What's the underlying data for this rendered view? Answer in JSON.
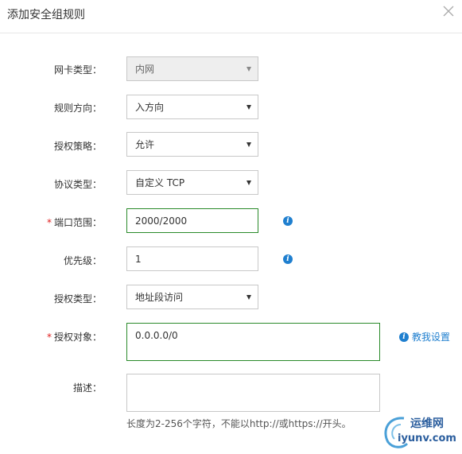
{
  "dialog": {
    "title": "添加安全组规则"
  },
  "form": {
    "nic_type": {
      "label": "网卡类型：",
      "value": "内网"
    },
    "direction": {
      "label": "规则方向：",
      "value": "入方向"
    },
    "policy": {
      "label": "授权策略：",
      "value": "允许"
    },
    "protocol": {
      "label": "协议类型：",
      "value": "自定义 TCP"
    },
    "port_range": {
      "label": "端口范围：",
      "required_mark": "*",
      "value": "2000/2000"
    },
    "priority": {
      "label": "优先级：",
      "value": "1"
    },
    "auth_type": {
      "label": "授权类型：",
      "value": "地址段访问"
    },
    "auth_object": {
      "label": "授权对象：",
      "required_mark": "*",
      "value": "0.0.0.0/0",
      "help_link": "教我设置"
    },
    "description": {
      "label": "描述：",
      "value": "",
      "hint": "长度为2-256个字符，不能以http://或https://开头。"
    }
  },
  "icons": {
    "close": "close-icon",
    "info": "info-icon",
    "dropdown": "chevron-down-icon"
  },
  "colors": {
    "accent": "#1f7fcf",
    "valid_border": "#2a8a2a",
    "required": "#e02020"
  },
  "watermark": {
    "cn": "运维网",
    "domain": "iyunv.com"
  }
}
